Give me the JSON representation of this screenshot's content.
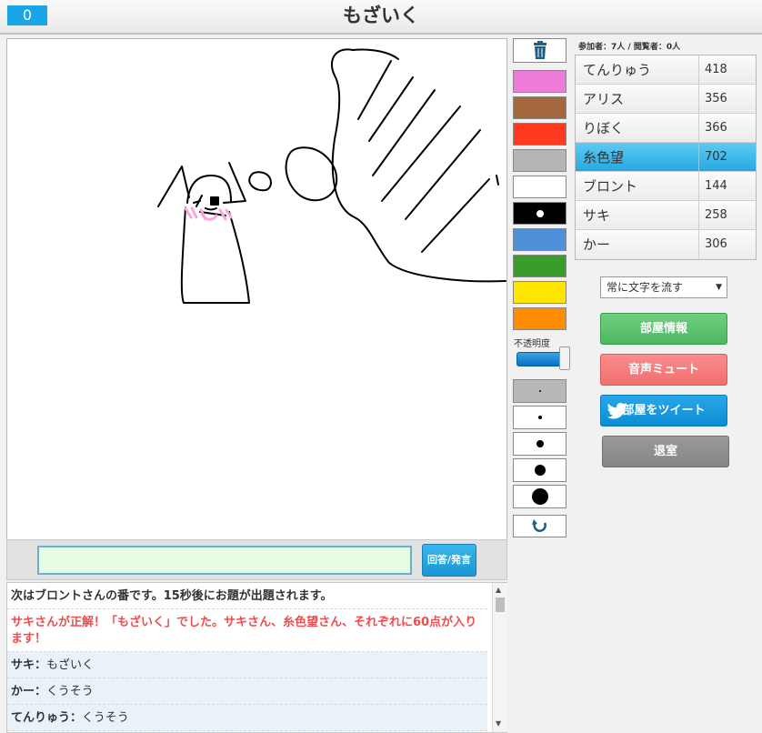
{
  "header": {
    "counter": "0",
    "title": "もざいく"
  },
  "palette": {
    "colors": [
      "#ee7ad9",
      "#a4683c",
      "#ff3a1f",
      "#b5b5b5",
      "#ffffff",
      "#000000",
      "#4d8fd8",
      "#3a9c2a",
      "#ffe600",
      "#ff8c00"
    ],
    "selected_color": "#000000",
    "opacity_label": "不透明度",
    "opacity_value": 1.0
  },
  "brush_sizes": {
    "options": [
      1,
      2,
      3,
      4,
      5
    ],
    "selected": 1
  },
  "room": {
    "participants_text": "参加者：7人 / 閲覧者：0人"
  },
  "players": [
    {
      "name": "てんりゅう",
      "score": "418"
    },
    {
      "name": "アリス",
      "score": "356"
    },
    {
      "name": "りぼく",
      "score": "366"
    },
    {
      "name": "糸色望",
      "score": "702"
    },
    {
      "name": "ブロント",
      "score": "144"
    },
    {
      "name": "サキ",
      "score": "258"
    },
    {
      "name": "かー",
      "score": "306"
    }
  ],
  "active_player": "糸色望",
  "controls": {
    "mode_select": "常に文字を流す",
    "room_info": "部屋情報",
    "mute": "音声ミュート",
    "tweet": "部屋をツイート",
    "leave": "退室"
  },
  "answer": {
    "value": "",
    "button": "回答/発言"
  },
  "chat": [
    {
      "type": "sys",
      "text": "次はブロントさんの番です。15秒後にお題が出題されます。"
    },
    {
      "type": "correct",
      "text": "サキさんが正解！「もざいく」でした。サキさん、糸色望さん、それぞれに60点が入ります！"
    },
    {
      "type": "chat",
      "who": "サキ",
      "text": "もざいく"
    },
    {
      "type": "chat",
      "who": "かー",
      "text": "くうそう"
    },
    {
      "type": "chat",
      "who": "てんりゅう",
      "text": "くうそう"
    }
  ]
}
